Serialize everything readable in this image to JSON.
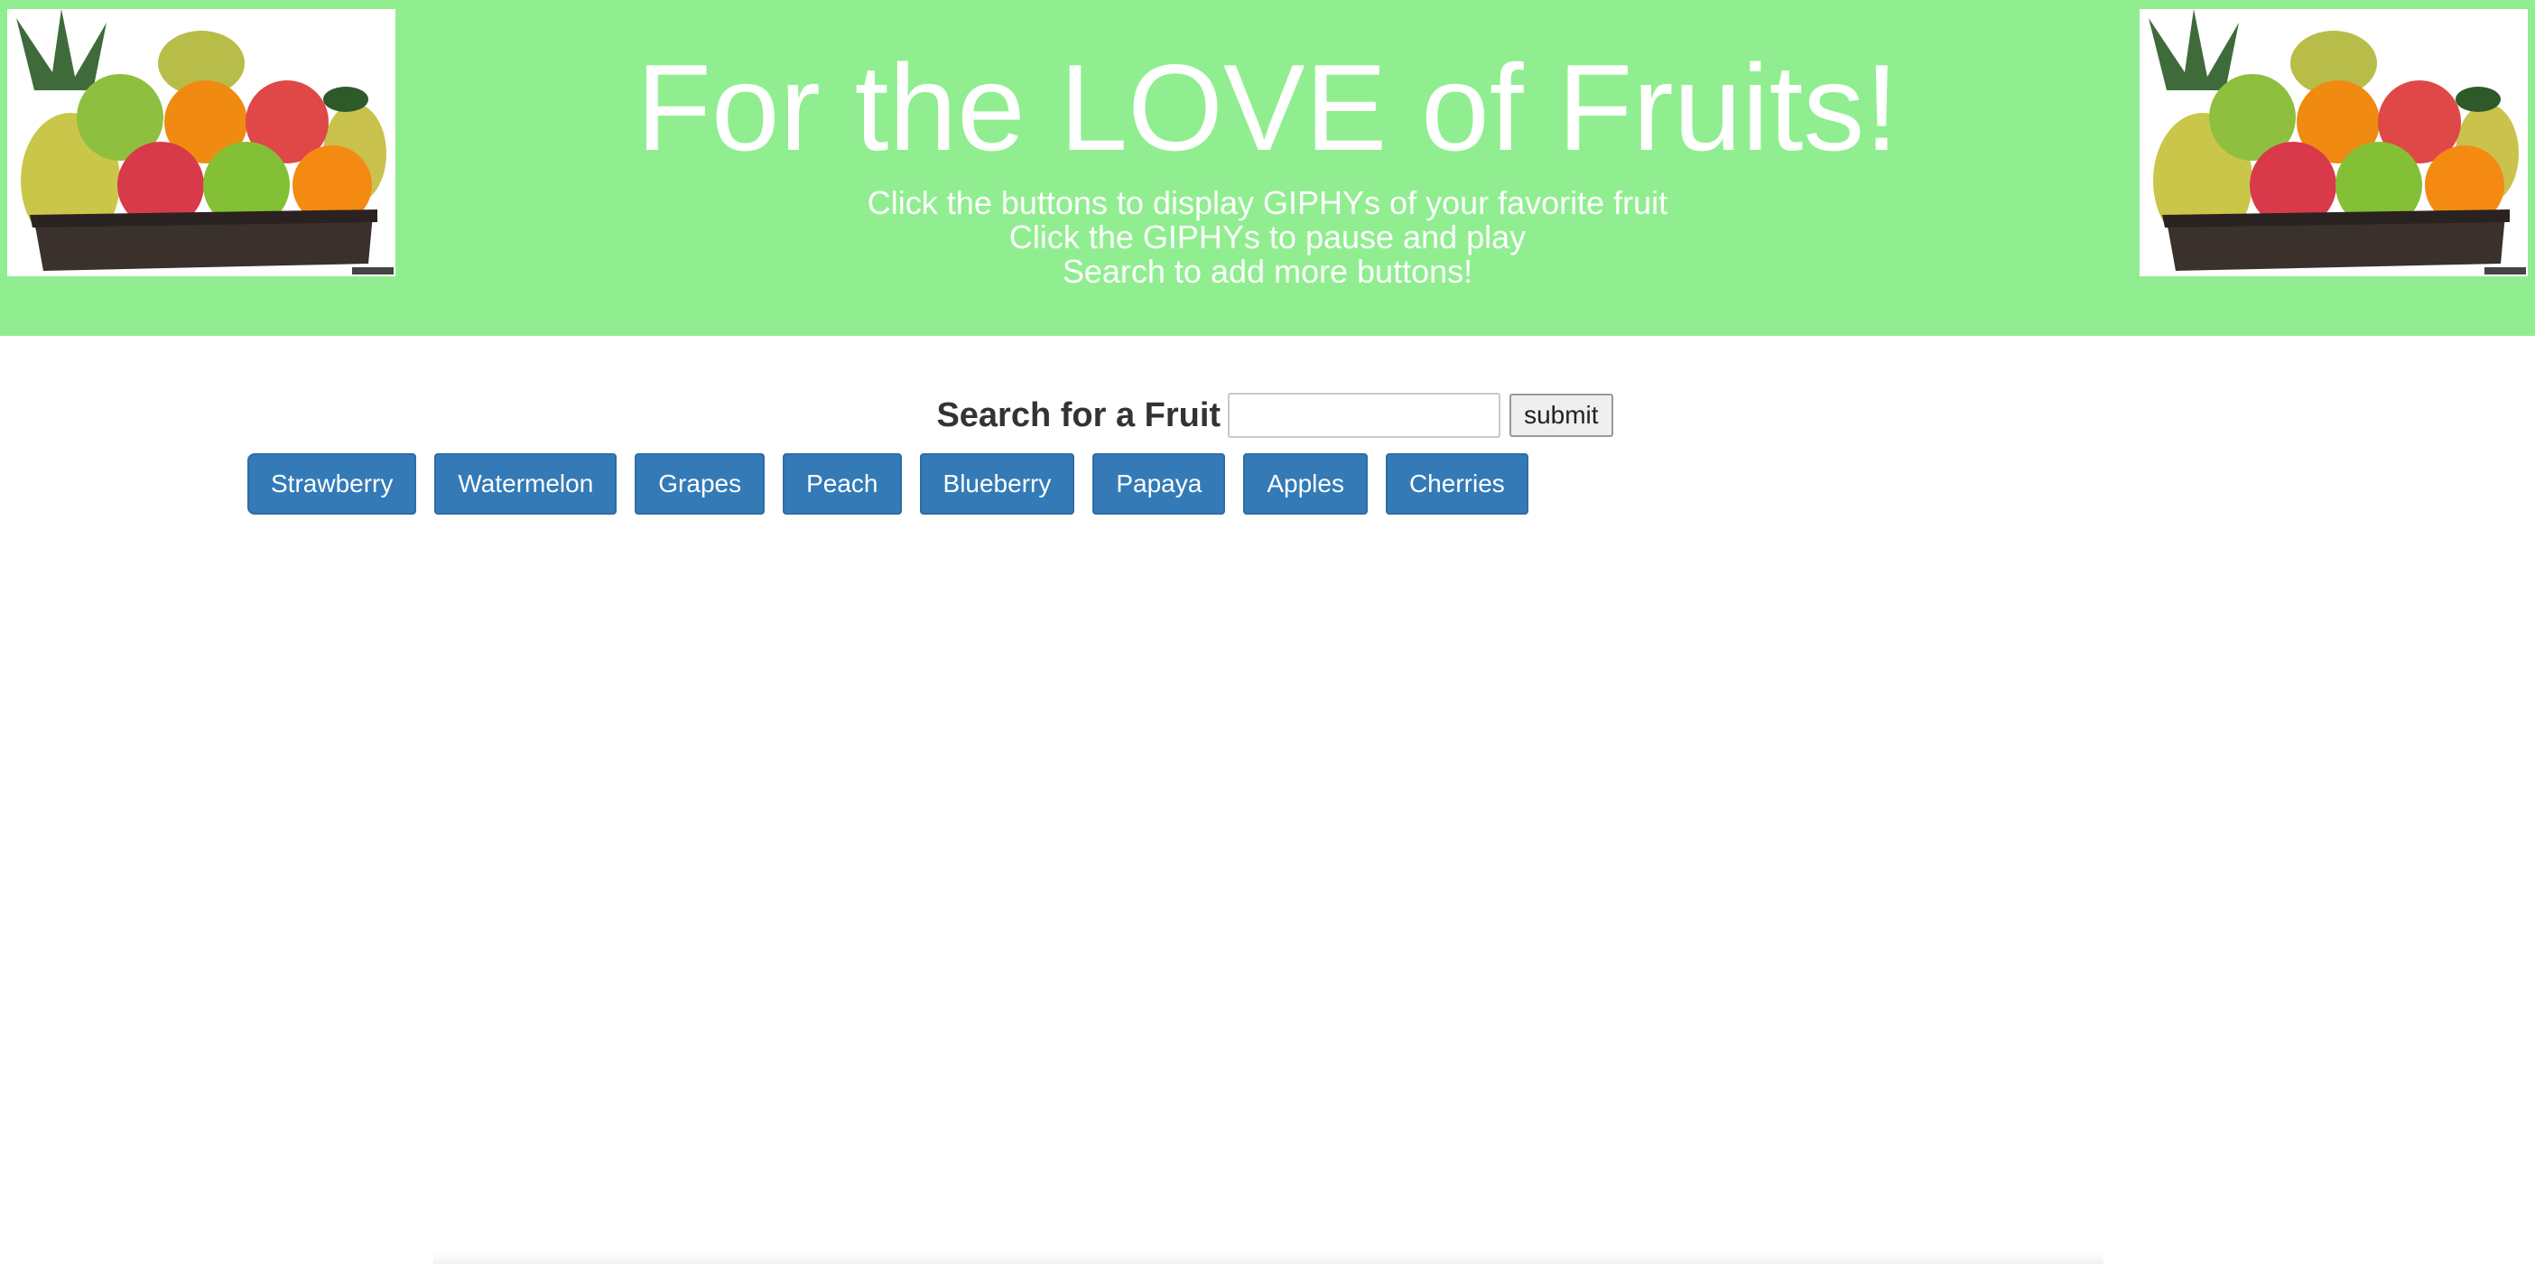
{
  "header": {
    "title": "For the LOVE of Fruits!",
    "instructions": [
      "Click the buttons to display GIPHYs of your favorite fruit",
      "Click the GIPHYs to pause and play",
      "Search to add more buttons!"
    ],
    "background_color": "#90ee90"
  },
  "search": {
    "label": "Search for a Fruit",
    "value": "",
    "placeholder": "",
    "submit_label": "submit"
  },
  "fruit_buttons": [
    {
      "label": "Strawberry"
    },
    {
      "label": "Watermelon"
    },
    {
      "label": "Grapes"
    },
    {
      "label": "Peach"
    },
    {
      "label": "Blueberry"
    },
    {
      "label": "Papaya"
    },
    {
      "label": "Apples"
    },
    {
      "label": "Cherries"
    }
  ],
  "colors": {
    "button_bg": "#337ab7",
    "button_text": "#ffffff"
  }
}
